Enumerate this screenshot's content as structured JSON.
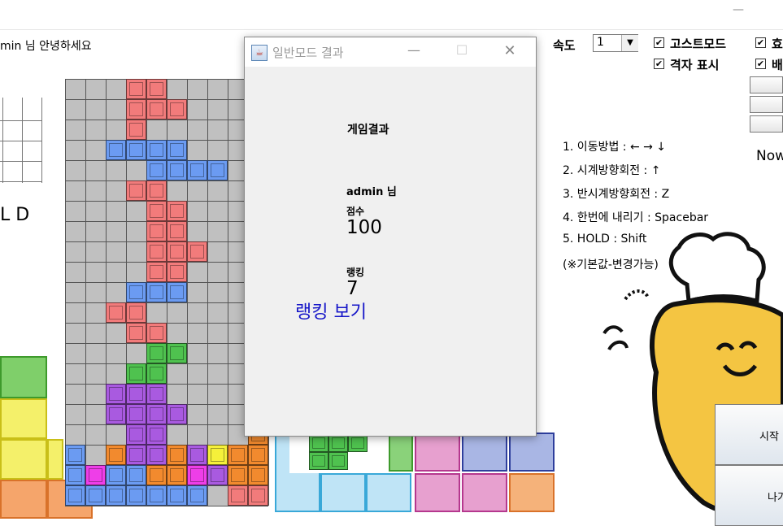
{
  "window": {
    "minimize_icon": "—"
  },
  "greeting": "min 님 안녕하세요",
  "hold": {
    "label": "L D"
  },
  "speed": {
    "label": "속도",
    "value": "1"
  },
  "options": [
    {
      "label": "고스트모드",
      "checked": true
    },
    {
      "label": "격자 표시",
      "checked": true
    },
    {
      "label": "효",
      "checked": true
    },
    {
      "label": "배",
      "checked": true
    }
  ],
  "side_buttons": [
    "",
    "",
    ""
  ],
  "now_label": "Now",
  "help": [
    "1. 이동방법 : ← → ↓",
    "2. 시계방향회전 : ↑",
    "3. 반시계방향회전 : Z",
    "4. 한번에 내리기 : Spacebar",
    "5. HOLD : Shift",
    "(※기본값-변경가능)"
  ],
  "big_buttons": [
    "시작",
    "나가"
  ],
  "dialog": {
    "title": "일반모드 결과",
    "heading": "게임결과",
    "user_line": "admin 님",
    "score_label": "점수",
    "score_value": "100",
    "rank_label": "랭킹",
    "rank_value": "7",
    "rank_link": "랭킹 보기"
  },
  "colors": {
    "red": "#f27b7b",
    "blue": "#6b9bf2",
    "green": "#4fc24f",
    "purple": "#a95ae0",
    "orange": "#f28a2e",
    "yellow": "#f5f03a",
    "magenta": "#ee3ee8",
    "board": "#c0c0c0",
    "link": "#1515c8"
  }
}
